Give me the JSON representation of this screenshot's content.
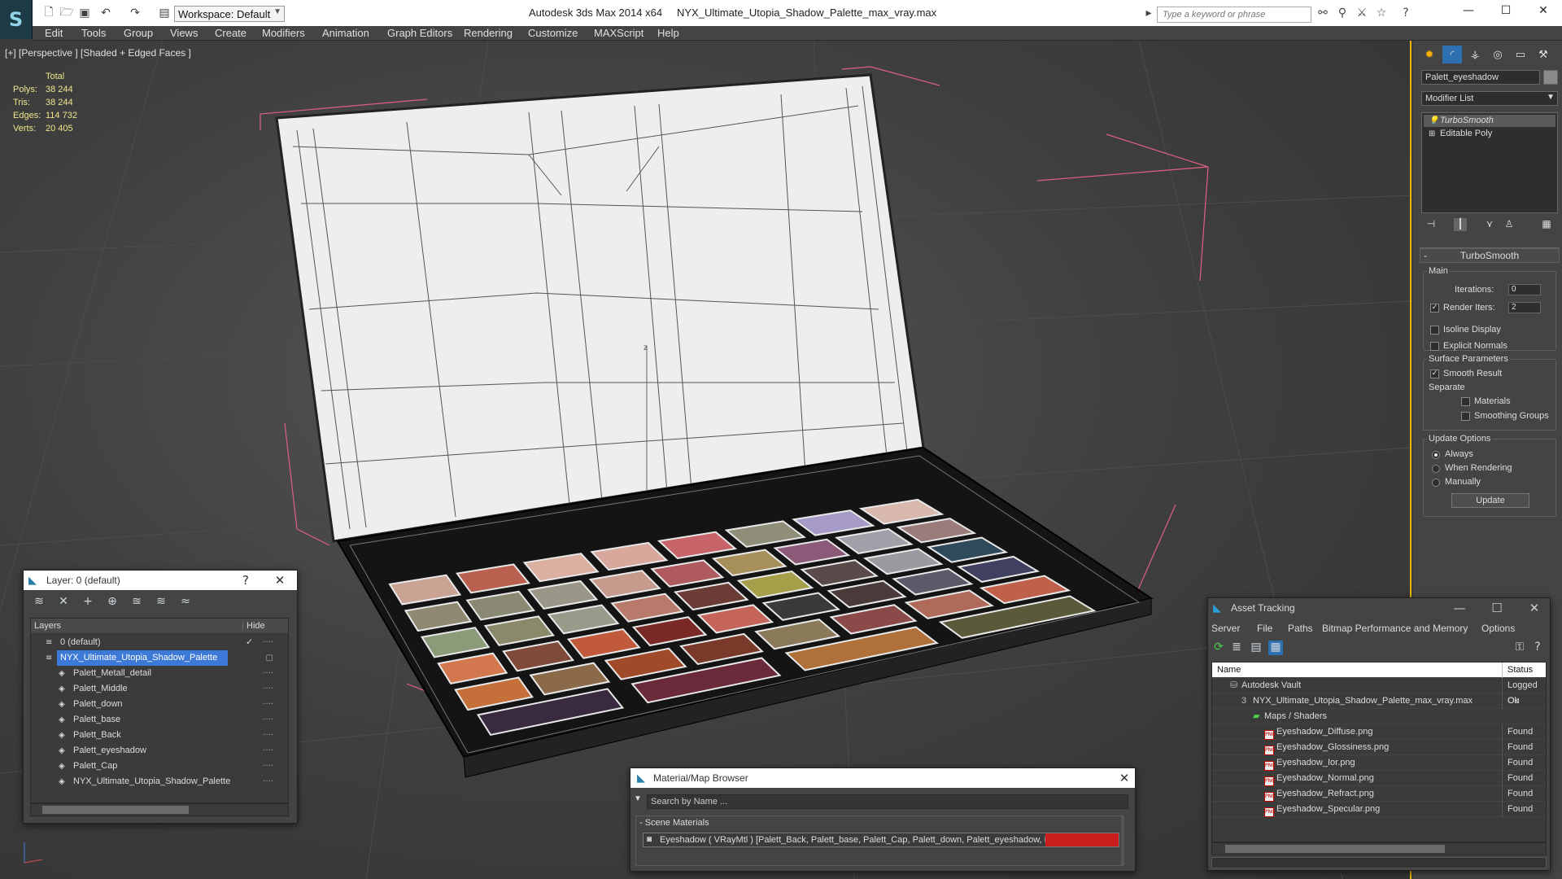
{
  "app": {
    "title": "Autodesk 3ds Max  2014 x64",
    "file": "NYX_Ultimate_Utopia_Shadow_Palette_max_vray.max",
    "workspace": "Workspace: Default",
    "search_placeholder": "Type a keyword or phrase"
  },
  "menu": [
    "Edit",
    "Tools",
    "Group",
    "Views",
    "Create",
    "Modifiers",
    "Animation",
    "Graph Editors",
    "Rendering",
    "Customize",
    "MAXScript",
    "Help"
  ],
  "viewport": {
    "label": "[+] [Perspective ] [Shaded + Edged Faces ]",
    "axis_label": "z",
    "stats": {
      "header": "Total",
      "rows": [
        {
          "key": "Polys:",
          "value": "38 244"
        },
        {
          "key": "Tris:",
          "value": "38 244"
        },
        {
          "key": "Edges:",
          "value": "114 732"
        },
        {
          "key": "Verts:",
          "value": "20 405"
        }
      ]
    }
  },
  "command_panel": {
    "object_name": "Palett_eyeshadow",
    "modifier_list": "Modifier List",
    "stack": [
      "TurboSmooth",
      "Editable Poly"
    ],
    "rollout": {
      "title": "TurboSmooth",
      "main": "Main",
      "iterations_label": "Iterations:",
      "iterations_value": "0",
      "render_iters_label": "Render Iters:",
      "render_iters_value": "2",
      "isoline": "Isoline Display",
      "explicit_normals": "Explicit Normals",
      "surface_params": "Surface Parameters",
      "smooth_result": "Smooth Result",
      "separate": "Separate",
      "materials": "Materials",
      "smoothing_groups": "Smoothing Groups",
      "update_options": "Update Options",
      "always": "Always",
      "when_rendering": "When Rendering",
      "manually": "Manually",
      "update_btn": "Update"
    }
  },
  "layer_window": {
    "title": "Layer: 0 (default)",
    "help": "?",
    "col_layers": "Layers",
    "col_hide": "Hide",
    "rows": [
      {
        "name": "0 (default)",
        "indent": 1
      },
      {
        "name": "NYX_Ultimate_Utopia_Shadow_Palette",
        "indent": 1,
        "selected": true
      },
      {
        "name": "Palett_Metall_detail",
        "indent": 2
      },
      {
        "name": "Palett_Middle",
        "indent": 2
      },
      {
        "name": "Palett_down",
        "indent": 2
      },
      {
        "name": "Palett_base",
        "indent": 2
      },
      {
        "name": "Palett_Back",
        "indent": 2
      },
      {
        "name": "Palett_eyeshadow",
        "indent": 2
      },
      {
        "name": "Palett_Cap",
        "indent": 2
      },
      {
        "name": "NYX_Ultimate_Utopia_Shadow_Palette",
        "indent": 2
      }
    ]
  },
  "material_browser": {
    "title": "Material/Map Browser",
    "search": "Search by Name ...",
    "section": "- Scene Materials",
    "item": "Eyeshadow  ( VRayMtl ) [Palett_Back, Palett_base, Palett_Cap, Palett_down, Palett_eyeshadow, Palett_Metall..."
  },
  "asset_tracking": {
    "title": "Asset Tracking",
    "menu": [
      "Server",
      "File",
      "Paths",
      "Bitmap Performance and Memory",
      "Options"
    ],
    "col_name": "Name",
    "col_status": "Status",
    "rows": [
      {
        "name": "Autodesk Vault",
        "status": "Logged Ou",
        "indent": 1,
        "icon": "vault"
      },
      {
        "name": "NYX_Ultimate_Utopia_Shadow_Palette_max_vray.max",
        "status": "Ok",
        "indent": 2,
        "icon": "max"
      },
      {
        "name": "Maps / Shaders",
        "status": "",
        "indent": 3,
        "icon": "folder"
      },
      {
        "name": "Eyeshadow_Diffuse.png",
        "status": "Found",
        "indent": 4,
        "icon": "png"
      },
      {
        "name": "Eyeshadow_Glossiness.png",
        "status": "Found",
        "indent": 4,
        "icon": "png"
      },
      {
        "name": "Eyeshadow_Ior.png",
        "status": "Found",
        "indent": 4,
        "icon": "png"
      },
      {
        "name": "Eyeshadow_Normal.png",
        "status": "Found",
        "indent": 4,
        "icon": "png"
      },
      {
        "name": "Eyeshadow_Refract.png",
        "status": "Found",
        "indent": 4,
        "icon": "png"
      },
      {
        "name": "Eyeshadow_Specular.png",
        "status": "Found",
        "indent": 4,
        "icon": "png"
      }
    ]
  },
  "palette_colors": [
    [
      "#caa393",
      "#b9604f",
      "#dcb0a0",
      "#d8a89c",
      "#c7646a",
      "#8f8e78",
      "#a69bc8",
      "#d8b8ad"
    ],
    [
      "#8f8972",
      "#8a8a74",
      "#9a9788",
      "#c79a8e",
      "#ae5a5f",
      "#a68f5a",
      "#8a5a78",
      "#a0a0a8",
      "#9b7c7b"
    ],
    [
      "#8b9b7a",
      "#8a8a6a",
      "#9a9a8a",
      "#b87a6a",
      "#6b3c36",
      "#a59f4a",
      "#5a4a4a",
      "#9a9aa0",
      "#2f4a5a"
    ],
    [
      "#d3784e",
      "#7f4a39",
      "#c05a3a",
      "#7a2a26",
      "#c5655a",
      "#3a3a3a",
      "#4a3a3a",
      "#5a5a68",
      "#404060"
    ],
    [
      "#c5703a",
      "#8b6a4a",
      "#a04a2a",
      "#7a3a2a",
      "#8a7a5a",
      "#8a4a4a",
      "#b06a5a",
      "#c0604a"
    ],
    [
      "#3a2a40",
      "#6a2a3a",
      "#b0703a",
      "#5a5a3a"
    ]
  ]
}
